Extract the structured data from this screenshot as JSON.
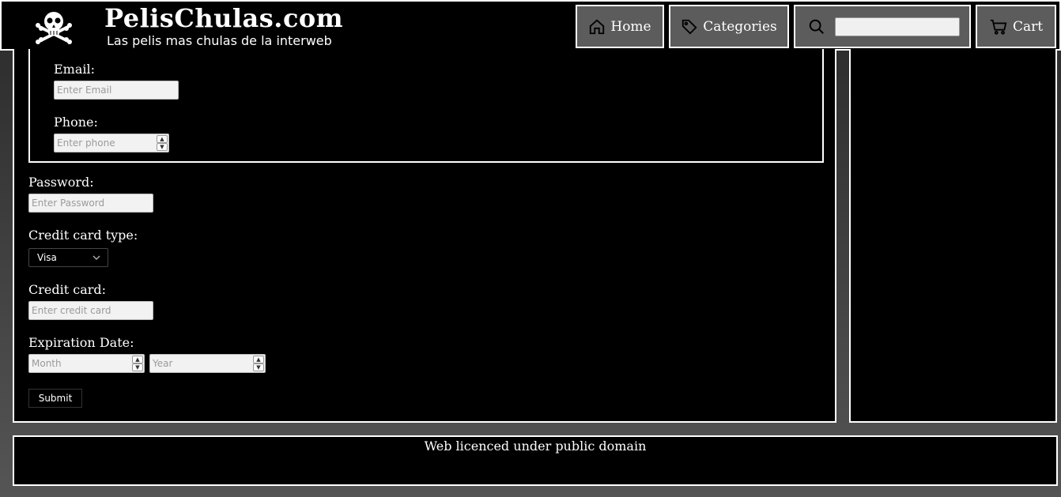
{
  "header": {
    "title": "PelisChulas.com",
    "subtitle": "Las pelis mas chulas de la interweb",
    "logo_icon": "skull-crossbones-icon",
    "nav": {
      "home_label": "Home",
      "categories_label": "Categories",
      "search_value": "",
      "cart_label": "Cart"
    }
  },
  "form": {
    "email_label": "Email:",
    "email_placeholder": "Enter Email",
    "phone_label": "Phone:",
    "phone_placeholder": "Enter phone",
    "password_label": "Password:",
    "password_placeholder": "Enter Password",
    "card_type_label": "Credit card type:",
    "card_type_selected": "Visa",
    "card_label": "Credit card:",
    "card_placeholder": "Enter credit card",
    "expiration_label": "Expiration Date:",
    "month_placeholder": "Month",
    "year_placeholder": "Year",
    "submit_label": "Submit"
  },
  "footer": {
    "text": "Web licenced under public domain"
  }
}
